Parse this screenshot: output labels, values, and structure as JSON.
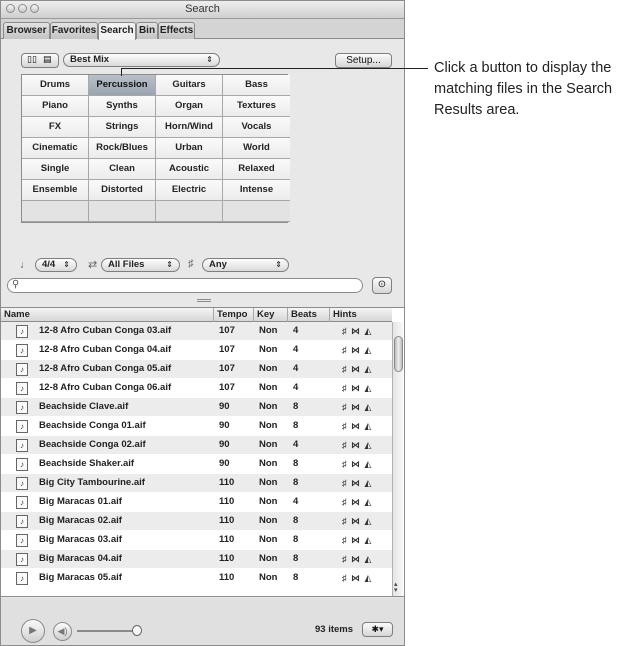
{
  "window": {
    "title": "Search"
  },
  "tabs": [
    "Browser",
    "Favorites",
    "Search",
    "Bin",
    "Effects"
  ],
  "active_tab": "Search",
  "toolbar": {
    "preset_value": "Best Mix",
    "setup_label": "Setup..."
  },
  "keyword_grid": {
    "rows": [
      [
        "Drums",
        "Percussion",
        "Guitars",
        "Bass"
      ],
      [
        "Piano",
        "Synths",
        "Organ",
        "Textures"
      ],
      [
        "FX",
        "Strings",
        "Horn/Wind",
        "Vocals"
      ],
      [
        "Cinematic",
        "Rock/Blues",
        "Urban",
        "World"
      ],
      [
        "Single",
        "Clean",
        "Acoustic",
        "Relaxed"
      ],
      [
        "Ensemble",
        "Distorted",
        "Electric",
        "Intense"
      ],
      [
        "",
        "",
        "",
        ""
      ]
    ],
    "selected": "Percussion"
  },
  "filters": {
    "time_signature": "4/4",
    "file_type": "All Files",
    "scale": "Any"
  },
  "search": {
    "placeholder": ""
  },
  "results": {
    "columns": [
      "Name",
      "Tempo",
      "Key",
      "Beats",
      "Hints"
    ],
    "rows": [
      {
        "name": "12-8 Afro Cuban Conga 03.aif",
        "tempo": "107",
        "key": "Non",
        "beats": "4"
      },
      {
        "name": "12-8 Afro Cuban Conga 04.aif",
        "tempo": "107",
        "key": "Non",
        "beats": "4"
      },
      {
        "name": "12-8 Afro Cuban Conga 05.aif",
        "tempo": "107",
        "key": "Non",
        "beats": "4"
      },
      {
        "name": "12-8 Afro Cuban Conga 06.aif",
        "tempo": "107",
        "key": "Non",
        "beats": "4"
      },
      {
        "name": "Beachside Clave.aif",
        "tempo": "90",
        "key": "Non",
        "beats": "8"
      },
      {
        "name": "Beachside Conga 01.aif",
        "tempo": "90",
        "key": "Non",
        "beats": "8"
      },
      {
        "name": "Beachside Conga 02.aif",
        "tempo": "90",
        "key": "Non",
        "beats": "4"
      },
      {
        "name": "Beachside Shaker.aif",
        "tempo": "90",
        "key": "Non",
        "beats": "8"
      },
      {
        "name": "Big City Tambourine.aif",
        "tempo": "110",
        "key": "Non",
        "beats": "8"
      },
      {
        "name": "Big Maracas 01.aif",
        "tempo": "110",
        "key": "Non",
        "beats": "4"
      },
      {
        "name": "Big Maracas 02.aif",
        "tempo": "110",
        "key": "Non",
        "beats": "8"
      },
      {
        "name": "Big Maracas 03.aif",
        "tempo": "110",
        "key": "Non",
        "beats": "8"
      },
      {
        "name": "Big Maracas 04.aif",
        "tempo": "110",
        "key": "Non",
        "beats": "8"
      },
      {
        "name": "Big Maracas 05.aif",
        "tempo": "110",
        "key": "Non",
        "beats": "8"
      }
    ]
  },
  "footer": {
    "item_count": "93 items"
  },
  "callout": {
    "text": "Click a button to display the matching files in the Search Results area."
  }
}
